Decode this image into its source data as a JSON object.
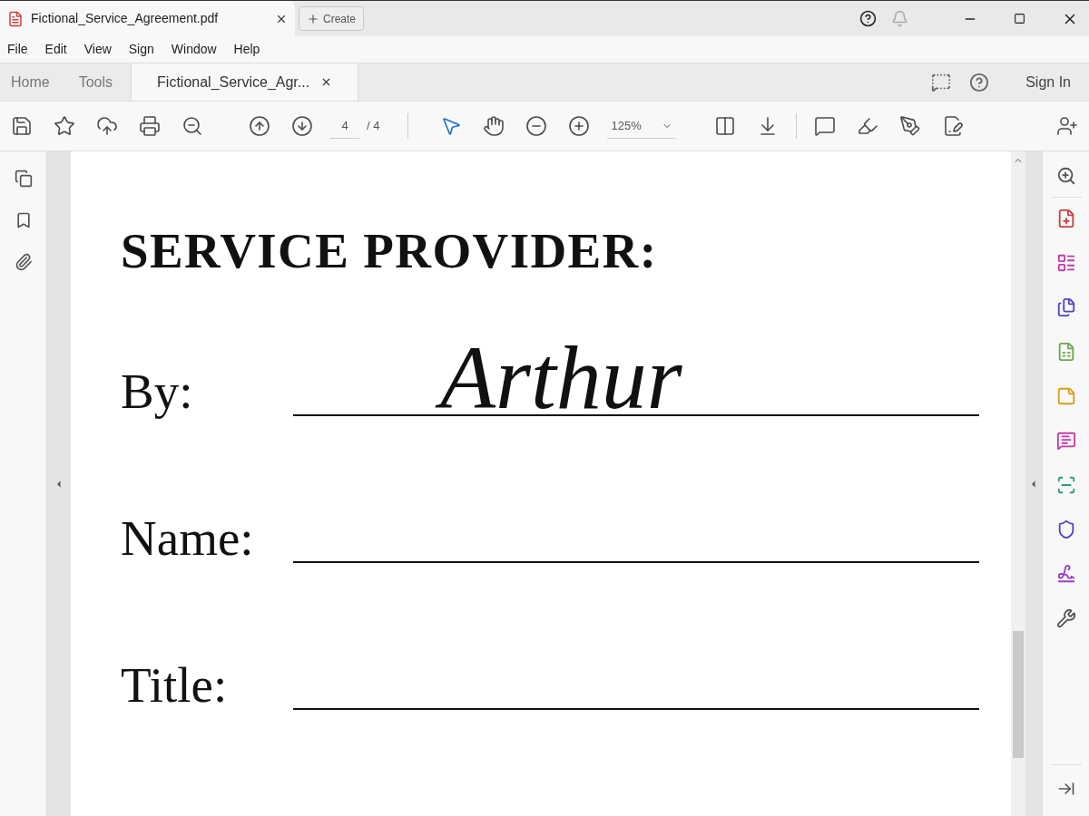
{
  "window": {
    "tab_title": "Fictional_Service_Agreement.pdf",
    "create_button": "Create"
  },
  "menu": [
    "File",
    "Edit",
    "View",
    "Sign",
    "Window",
    "Help"
  ],
  "tabs": [
    {
      "label": "Home",
      "selected": false
    },
    {
      "label": "Tools",
      "selected": false
    },
    {
      "label": "Fictional_Service_Agr...",
      "selected": true,
      "closable": true
    }
  ],
  "sign_in": "Sign In",
  "toolbar": {
    "page_number": "4",
    "page_total": "/ 4",
    "zoom": "125%"
  },
  "document": {
    "heading": "SERVICE PROVIDER:",
    "fields": [
      {
        "label": "By:",
        "signature": "Arthur"
      },
      {
        "label": "Name:"
      },
      {
        "label": "Title:"
      }
    ]
  },
  "right_tools": [
    {
      "kind": "export",
      "color": "#c94040"
    },
    {
      "kind": "organize",
      "color": "#c43aa8"
    },
    {
      "kind": "combine",
      "color": "#4f46c8"
    },
    {
      "kind": "excel",
      "color": "#6aa84f"
    },
    {
      "kind": "note",
      "color": "#d4a017"
    },
    {
      "kind": "comment",
      "color": "#c43aa8"
    },
    {
      "kind": "scan",
      "color": "#2e9e6e"
    },
    {
      "kind": "protect",
      "color": "#4f46c8"
    },
    {
      "kind": "sign",
      "color": "#9b3fc4"
    },
    {
      "kind": "more",
      "color": "#555555"
    }
  ]
}
